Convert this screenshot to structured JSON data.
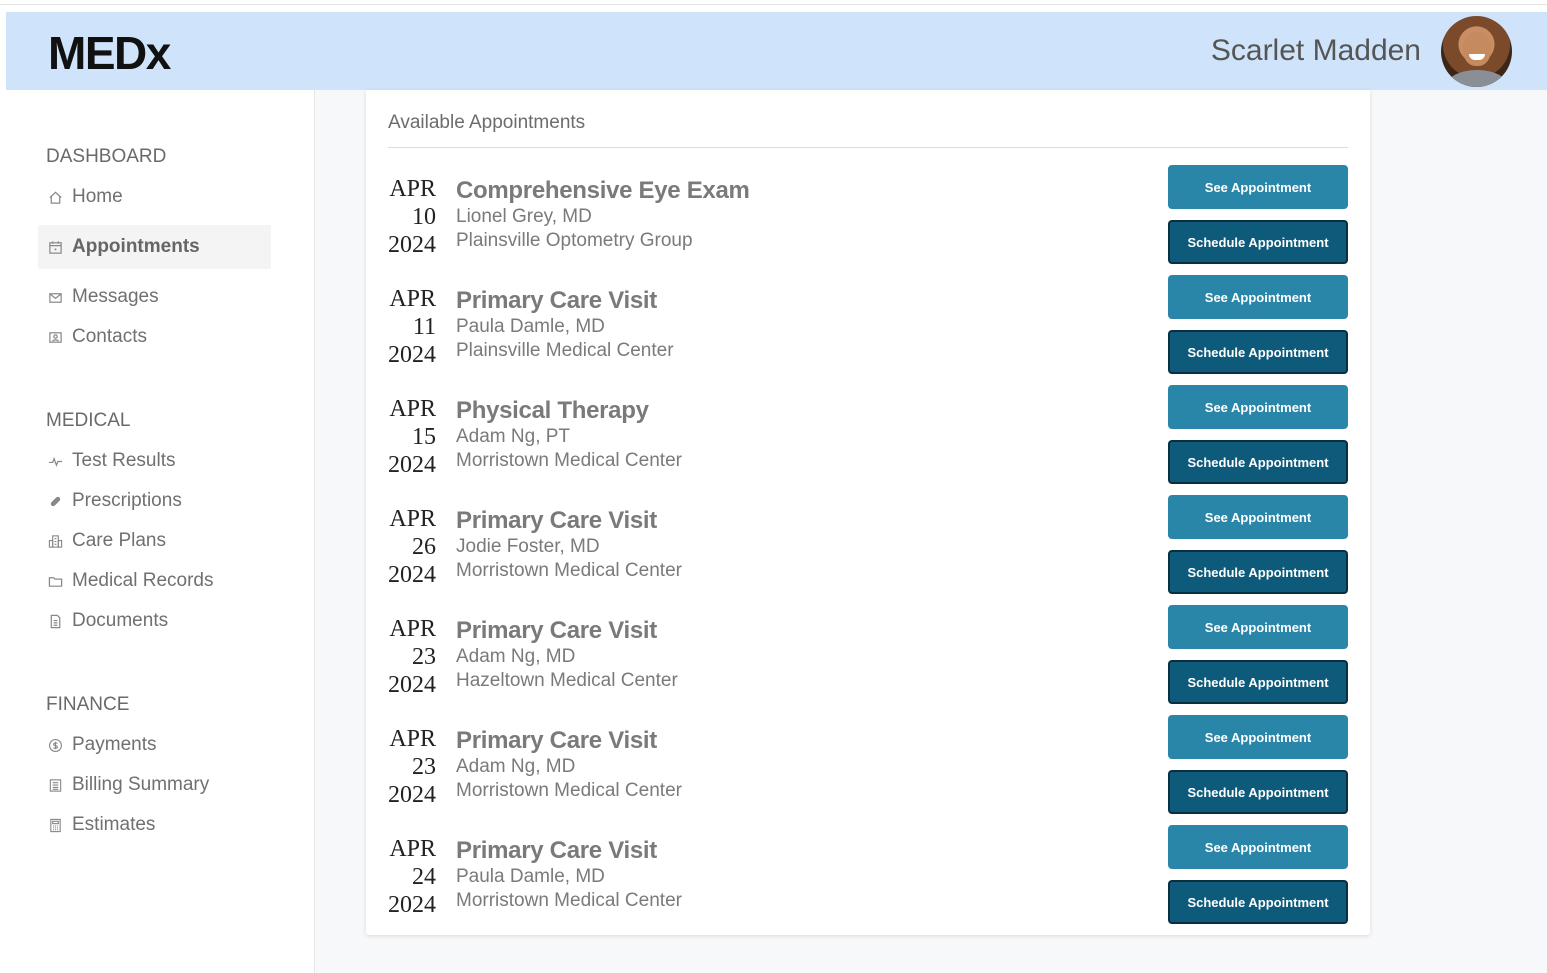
{
  "header": {
    "logo": "MEDx",
    "user_name": "Scarlet Madden"
  },
  "sidebar": {
    "sections": [
      {
        "title": "DASHBOARD",
        "items": [
          {
            "label": "Home",
            "icon": "home-icon"
          },
          {
            "label": "Appointments",
            "icon": "calendar-icon",
            "active": true
          },
          {
            "label": "Messages",
            "icon": "envelope-icon"
          },
          {
            "label": "Contacts",
            "icon": "contact-card-icon"
          }
        ]
      },
      {
        "title": "MEDICAL",
        "items": [
          {
            "label": "Test Results",
            "icon": "pulse-icon"
          },
          {
            "label": "Prescriptions",
            "icon": "pill-icon"
          },
          {
            "label": "Care Plans",
            "icon": "building-icon"
          },
          {
            "label": "Medical Records",
            "icon": "folder-icon"
          },
          {
            "label": "Documents",
            "icon": "document-icon"
          }
        ]
      },
      {
        "title": "FINANCE",
        "items": [
          {
            "label": "Payments",
            "icon": "dollar-coin-icon"
          },
          {
            "label": "Billing Summary",
            "icon": "receipt-icon"
          },
          {
            "label": "Estimates",
            "icon": "calculator-icon"
          }
        ]
      }
    ]
  },
  "main": {
    "card_title": "Available Appointments",
    "see_label": "See Appointment",
    "schedule_label": "Schedule Appointment",
    "appointments": [
      {
        "month": "APR",
        "day": "10",
        "year": "2024",
        "title": "Comprehensive Eye Exam",
        "provider": "Lionel Grey, MD",
        "location": "Plainsville Optometry Group"
      },
      {
        "month": "APR",
        "day": "11",
        "year": "2024",
        "title": "Primary Care Visit",
        "provider": "Paula Damle, MD",
        "location": "Plainsville Medical Center"
      },
      {
        "month": "APR",
        "day": "15",
        "year": "2024",
        "title": "Physical Therapy",
        "provider": "Adam Ng, PT",
        "location": "Morristown Medical Center"
      },
      {
        "month": "APR",
        "day": "26",
        "year": "2024",
        "title": "Primary Care Visit",
        "provider": "Jodie Foster, MD",
        "location": "Morristown Medical Center"
      },
      {
        "month": "APR",
        "day": "23",
        "year": "2024",
        "title": "Primary Care Visit",
        "provider": "Adam Ng, MD",
        "location": "Hazeltown Medical Center"
      },
      {
        "month": "APR",
        "day": "23",
        "year": "2024",
        "title": "Primary Care Visit",
        "provider": "Adam Ng, MD",
        "location": "Morristown Medical Center"
      },
      {
        "month": "APR",
        "day": "24",
        "year": "2024",
        "title": "Primary Care Visit",
        "provider": "Paula Damle, MD",
        "location": "Morristown Medical Center"
      }
    ]
  },
  "colors": {
    "header_bg": "#cfe4fb",
    "see_button": "#2a86a8",
    "schedule_button": "#0e5a7b"
  }
}
